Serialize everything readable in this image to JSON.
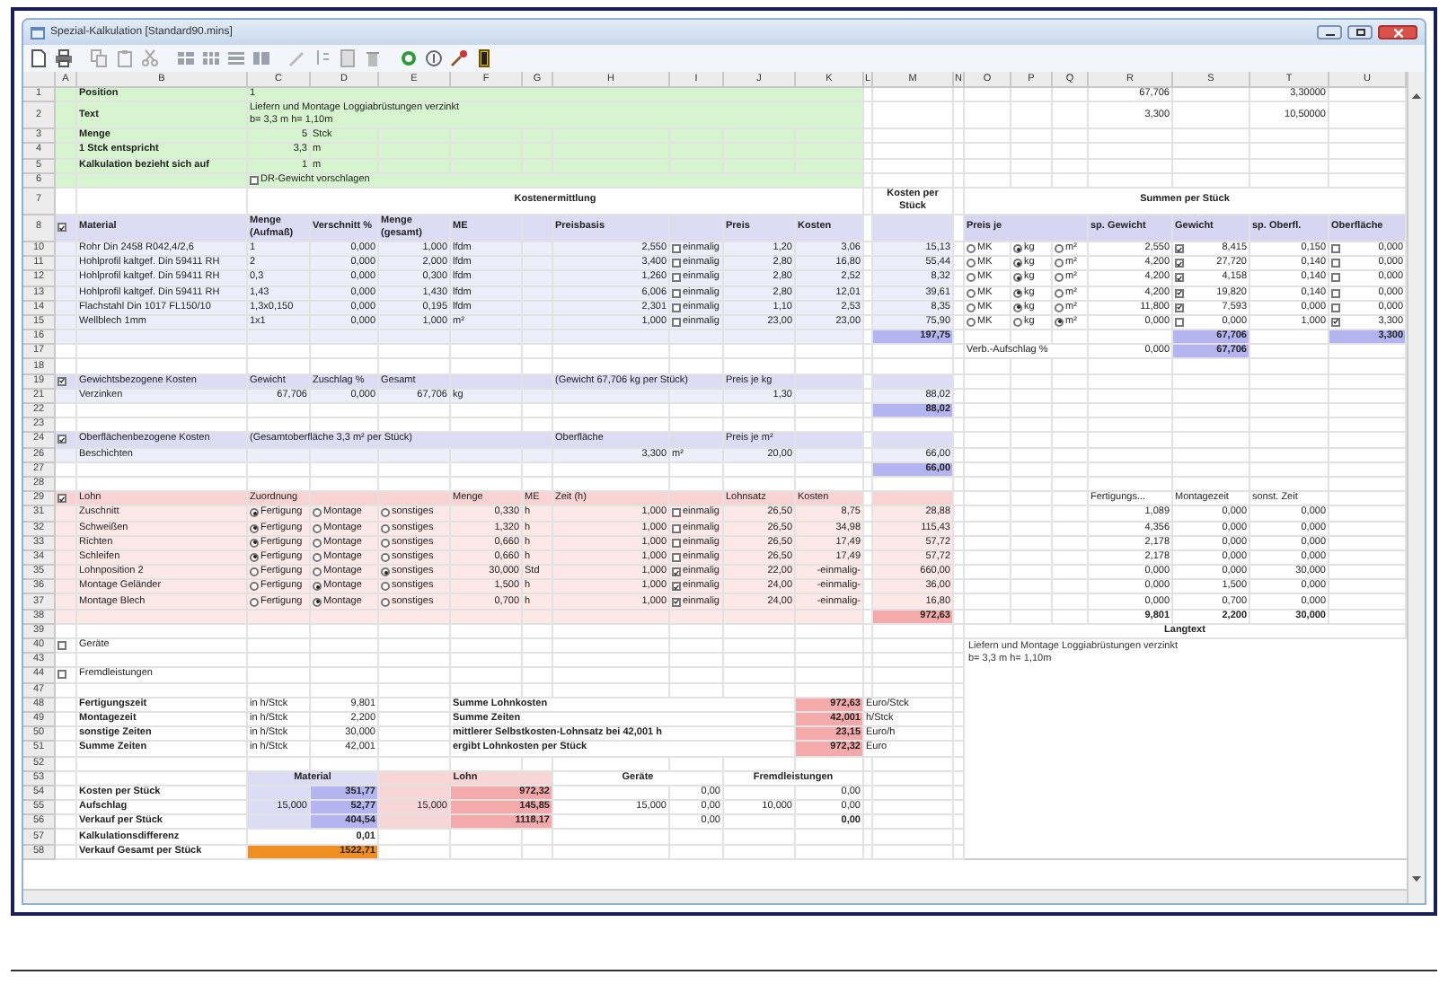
{
  "window": {
    "title": "Spezial-Kalkulation [Standard90.mins]"
  },
  "columns": [
    "A",
    "B",
    "C",
    "D",
    "E",
    "F",
    "G",
    "H",
    "I",
    "J",
    "K",
    "L",
    "M",
    "N",
    "O",
    "P",
    "Q",
    "R",
    "S",
    "T",
    "U"
  ],
  "rows": [
    {
      "number": "1",
      "kind": "header",
      "cells": {
        "B": {
          "kind": "label",
          "text": "Position"
        },
        "C": {
          "kind": "text",
          "merged": true,
          "text": "1"
        },
        "R": {
          "kind": "num",
          "text": "67,706"
        },
        "T": {
          "kind": "num",
          "text": "3,30000"
        }
      }
    },
    {
      "number": "2",
      "kind": "header",
      "cells": {
        "B": {
          "kind": "label",
          "text": "Text"
        },
        "C": {
          "kind": "text",
          "merged": true,
          "lines": [
            "Liefern und  Montage Loggiabrüstungen verzinkt",
            "b= 3,3 m h= 1,10m"
          ]
        },
        "R": {
          "kind": "num",
          "text": "3,300"
        },
        "T": {
          "kind": "num",
          "text": "10,50000"
        }
      }
    },
    {
      "number": "3",
      "kind": "header",
      "cells": {
        "B": {
          "kind": "label",
          "text": "Menge"
        },
        "C": {
          "kind": "num",
          "text": "5"
        },
        "D": {
          "kind": "text",
          "text": "Stck"
        }
      }
    },
    {
      "number": "4",
      "kind": "header",
      "cells": {
        "B": {
          "kind": "label",
          "text": "1 Stck entspricht"
        },
        "C": {
          "kind": "num",
          "text": "3,3"
        },
        "D": {
          "kind": "text",
          "text": "m"
        }
      }
    },
    {
      "number": "5",
      "kind": "header",
      "cells": {
        "B": {
          "kind": "label",
          "text": "Kalkulation bezieht sich auf"
        },
        "C": {
          "kind": "num",
          "text": "1"
        },
        "D": {
          "kind": "text",
          "text": "m"
        }
      }
    },
    {
      "number": "6",
      "kind": "header",
      "cells": {
        "C": {
          "kind": "check",
          "merged": true,
          "checked": false,
          "text": "DR-Gewicht vorschlagen"
        }
      }
    },
    {
      "number": "7",
      "kind": "plain",
      "cells": {
        "C": {
          "kind": "title",
          "merged": true,
          "text": "Kostenermittlung"
        },
        "M": {
          "kind": "title",
          "text": "Kosten per Stück"
        },
        "O": {
          "kind": "title",
          "merged": true,
          "text": "Summen per Stück"
        }
      }
    },
    {
      "number": "8",
      "kind": "material-head",
      "cells": {
        "A": {
          "kind": "check",
          "checked": true
        },
        "B": {
          "kind": "label",
          "text": "Material"
        },
        "C": {
          "kind": "label",
          "text": "Menge (Aufmaß)"
        },
        "D": {
          "kind": "label",
          "text": "Verschnitt %"
        },
        "E": {
          "kind": "label",
          "text": "Menge (gesamt)"
        },
        "F": {
          "kind": "label",
          "text": "ME"
        },
        "H": {
          "kind": "label",
          "text": "Preisbasis"
        },
        "J": {
          "kind": "label",
          "text": "Preis"
        },
        "K": {
          "kind": "label",
          "text": "Kosten"
        },
        "O": {
          "kind": "head",
          "merged": true,
          "text": "Preis je"
        },
        "R": {
          "kind": "head",
          "text": "sp. Gewicht"
        },
        "S": {
          "kind": "head",
          "text": "Gewicht"
        },
        "T": {
          "kind": "head",
          "text": "sp. Oberfl."
        },
        "U": {
          "kind": "head",
          "text": "Oberfläche"
        }
      }
    },
    {
      "number": "10",
      "kind": "material",
      "cells": {
        "B": {
          "kind": "text",
          "text": "Rohr Din 2458 R042,4/2,6"
        },
        "C": {
          "kind": "text",
          "text": "1"
        },
        "D": {
          "kind": "num",
          "text": "0,000"
        },
        "E": {
          "kind": "num",
          "text": "1,000"
        },
        "F": {
          "kind": "text",
          "text": "lfdm"
        },
        "H": {
          "kind": "num",
          "text": "2,550"
        },
        "I": {
          "kind": "check",
          "checked": false,
          "text": "einmalig"
        },
        "J": {
          "kind": "num",
          "text": "1,20"
        },
        "K": {
          "kind": "num",
          "text": "3,06"
        },
        "M": {
          "kind": "num",
          "text": "15,13"
        },
        "O": {
          "kind": "radio",
          "selected": false,
          "text": "MK"
        },
        "P": {
          "kind": "radio",
          "selected": true,
          "text": "kg"
        },
        "Q": {
          "kind": "radio",
          "selected": false,
          "text": "m²"
        },
        "R": {
          "kind": "num",
          "text": "2,550"
        },
        "S": {
          "kind": "checknum",
          "checked": true,
          "text": "8,415"
        },
        "T": {
          "kind": "num",
          "text": "0,150"
        },
        "U": {
          "kind": "checknum",
          "checked": false,
          "text": "0,000"
        }
      }
    },
    {
      "number": "11",
      "kind": "material",
      "cells": {
        "B": {
          "kind": "text",
          "text": "Hohlprofil kaltgef. Din 59411 RH"
        },
        "C": {
          "kind": "text",
          "text": "2"
        },
        "D": {
          "kind": "num",
          "text": "0,000"
        },
        "E": {
          "kind": "num",
          "text": "2,000"
        },
        "F": {
          "kind": "text",
          "text": "lfdm"
        },
        "H": {
          "kind": "num",
          "text": "3,400"
        },
        "I": {
          "kind": "check",
          "checked": false,
          "text": "einmalig"
        },
        "J": {
          "kind": "num",
          "text": "2,80"
        },
        "K": {
          "kind": "num",
          "text": "16,80"
        },
        "M": {
          "kind": "num",
          "text": "55,44"
        },
        "O": {
          "kind": "radio",
          "selected": false,
          "text": "MK"
        },
        "P": {
          "kind": "radio",
          "selected": true,
          "text": "kg"
        },
        "Q": {
          "kind": "radio",
          "selected": false,
          "text": "m²"
        },
        "R": {
          "kind": "num",
          "text": "4,200"
        },
        "S": {
          "kind": "checknum",
          "checked": true,
          "text": "27,720"
        },
        "T": {
          "kind": "num",
          "text": "0,140"
        },
        "U": {
          "kind": "checknum",
          "checked": false,
          "text": "0,000"
        }
      }
    },
    {
      "number": "12",
      "kind": "material",
      "cells": {
        "B": {
          "kind": "text",
          "text": "Hohlprofil kaltgef. Din 59411 RH"
        },
        "C": {
          "kind": "text",
          "text": "0,3"
        },
        "D": {
          "kind": "num",
          "text": "0,000"
        },
        "E": {
          "kind": "num",
          "text": "0,300"
        },
        "F": {
          "kind": "text",
          "text": "lfdm"
        },
        "H": {
          "kind": "num",
          "text": "1,260"
        },
        "I": {
          "kind": "check",
          "checked": false,
          "text": "einmalig"
        },
        "J": {
          "kind": "num",
          "text": "2,80"
        },
        "K": {
          "kind": "num",
          "text": "2,52"
        },
        "M": {
          "kind": "num",
          "text": "8,32"
        },
        "O": {
          "kind": "radio",
          "selected": false,
          "text": "MK"
        },
        "P": {
          "kind": "radio",
          "selected": true,
          "text": "kg"
        },
        "Q": {
          "kind": "radio",
          "selected": false,
          "text": "m²"
        },
        "R": {
          "kind": "num",
          "text": "4,200"
        },
        "S": {
          "kind": "checknum",
          "checked": true,
          "text": "4,158"
        },
        "T": {
          "kind": "num",
          "text": "0,140"
        },
        "U": {
          "kind": "checknum",
          "checked": false,
          "text": "0,000"
        }
      }
    },
    {
      "number": "13",
      "kind": "material",
      "cells": {
        "B": {
          "kind": "text",
          "text": "Hohlprofil kaltgef. Din 59411 RH"
        },
        "C": {
          "kind": "text",
          "text": "1,43"
        },
        "D": {
          "kind": "num",
          "text": "0,000"
        },
        "E": {
          "kind": "num",
          "text": "1,430"
        },
        "F": {
          "kind": "text",
          "text": "lfdm"
        },
        "H": {
          "kind": "num",
          "text": "6,006"
        },
        "I": {
          "kind": "check",
          "checked": false,
          "text": "einmalig"
        },
        "J": {
          "kind": "num",
          "text": "2,80"
        },
        "K": {
          "kind": "num",
          "text": "12,01"
        },
        "M": {
          "kind": "num",
          "text": "39,61"
        },
        "O": {
          "kind": "radio",
          "selected": false,
          "text": "MK"
        },
        "P": {
          "kind": "radio",
          "selected": true,
          "text": "kg"
        },
        "Q": {
          "kind": "radio",
          "selected": false,
          "text": "m²"
        },
        "R": {
          "kind": "num",
          "text": "4,200"
        },
        "S": {
          "kind": "checknum",
          "checked": true,
          "text": "19,820"
        },
        "T": {
          "kind": "num",
          "text": "0,140"
        },
        "U": {
          "kind": "checknum",
          "checked": false,
          "text": "0,000"
        }
      }
    },
    {
      "number": "14",
      "kind": "material",
      "cells": {
        "B": {
          "kind": "text",
          "text": "Flachstahl Din 1017 FL150/10"
        },
        "C": {
          "kind": "text",
          "text": "1,3x0,150"
        },
        "D": {
          "kind": "num",
          "text": "0,000"
        },
        "E": {
          "kind": "num",
          "text": "0,195"
        },
        "F": {
          "kind": "text",
          "text": "lfdm"
        },
        "H": {
          "kind": "num",
          "text": "2,301"
        },
        "I": {
          "kind": "check",
          "checked": false,
          "text": "einmalig"
        },
        "J": {
          "kind": "num",
          "text": "1,10"
        },
        "K": {
          "kind": "num",
          "text": "2,53"
        },
        "M": {
          "kind": "num",
          "text": "8,35"
        },
        "O": {
          "kind": "radio",
          "selected": false,
          "text": "MK"
        },
        "P": {
          "kind": "radio",
          "selected": true,
          "text": "kg"
        },
        "Q": {
          "kind": "radio",
          "selected": false,
          "text": "m²"
        },
        "R": {
          "kind": "num",
          "text": "11,800"
        },
        "S": {
          "kind": "checknum",
          "checked": true,
          "text": "7,593"
        },
        "T": {
          "kind": "num",
          "text": "0,000"
        },
        "U": {
          "kind": "checknum",
          "checked": false,
          "text": "0,000"
        }
      }
    },
    {
      "number": "15",
      "kind": "material",
      "cells": {
        "B": {
          "kind": "text",
          "text": "Wellblech 1mm"
        },
        "C": {
          "kind": "text",
          "text": "1x1"
        },
        "D": {
          "kind": "num",
          "text": "0,000"
        },
        "E": {
          "kind": "num",
          "text": "1,000"
        },
        "F": {
          "kind": "text",
          "text": "m²"
        },
        "H": {
          "kind": "num",
          "text": "1,000"
        },
        "I": {
          "kind": "check",
          "checked": false,
          "text": "einmalig"
        },
        "J": {
          "kind": "num",
          "text": "23,00"
        },
        "K": {
          "kind": "num",
          "text": "23,00"
        },
        "M": {
          "kind": "num",
          "text": "75,90"
        },
        "O": {
          "kind": "radio",
          "selected": false,
          "text": "MK"
        },
        "P": {
          "kind": "radio",
          "selected": false,
          "text": "kg"
        },
        "Q": {
          "kind": "radio",
          "selected": true,
          "text": "m²"
        },
        "R": {
          "kind": "num",
          "text": "0,000"
        },
        "S": {
          "kind": "checknum",
          "checked": false,
          "text": "0,000"
        },
        "T": {
          "kind": "num",
          "text": "1,000"
        },
        "U": {
          "kind": "checknum",
          "checked": true,
          "text": "3,300"
        }
      }
    },
    {
      "number": "16",
      "kind": "material",
      "cells": {
        "M": {
          "kind": "msum",
          "text": "197,75"
        },
        "S": {
          "kind": "msum",
          "text": "67,706"
        },
        "U": {
          "kind": "msum",
          "text": "3,300"
        }
      }
    },
    {
      "number": "17",
      "kind": "plain",
      "cells": {
        "O": {
          "kind": "text",
          "merged": true,
          "text": "Verb.-Aufschlag %"
        },
        "R": {
          "kind": "num",
          "text": "0,000"
        },
        "S": {
          "kind": "msum",
          "text": "67,706"
        }
      }
    },
    {
      "number": "18",
      "kind": "plain",
      "cells": {}
    },
    {
      "number": "19",
      "kind": "material-head",
      "cells": {
        "A": {
          "kind": "check",
          "checked": true
        },
        "B": {
          "kind": "text",
          "text": "Gewichtsbezogene Kosten"
        },
        "C": {
          "kind": "text",
          "text": "Gewicht"
        },
        "D": {
          "kind": "text",
          "text": "Zuschlag %"
        },
        "E": {
          "kind": "text",
          "text": "Gesamt"
        },
        "H": {
          "kind": "text",
          "merged": true,
          "text": "(Gewicht 67,706 kg per Stück)"
        },
        "J": {
          "kind": "text",
          "text": "Preis je kg"
        }
      }
    },
    {
      "number": "21",
      "kind": "material",
      "cells": {
        "B": {
          "kind": "text",
          "text": "Verzinken"
        },
        "C": {
          "kind": "num",
          "text": "67,706"
        },
        "D": {
          "kind": "num",
          "text": "0,000"
        },
        "E": {
          "kind": "num",
          "text": "67,706"
        },
        "F": {
          "kind": "text",
          "text": "kg"
        },
        "J": {
          "kind": "num",
          "text": "1,30"
        },
        "M": {
          "kind": "num",
          "text": "88,02"
        }
      }
    },
    {
      "number": "22",
      "kind": "plain",
      "cells": {
        "M": {
          "kind": "msum",
          "text": "88,02"
        }
      }
    },
    {
      "number": "23",
      "kind": "plain",
      "cells": {}
    },
    {
      "number": "24",
      "kind": "material-head",
      "cells": {
        "A": {
          "kind": "check",
          "checked": true
        },
        "B": {
          "kind": "text",
          "text": "Oberflächenbezogene Kosten"
        },
        "C": {
          "kind": "text",
          "merged": true,
          "text": "(Gesamtoberfläche 3,3 m² per Stück)"
        },
        "H": {
          "kind": "text",
          "text": "Oberfläche"
        },
        "J": {
          "kind": "text",
          "text": "Preis je m²"
        }
      }
    },
    {
      "number": "26",
      "kind": "material",
      "cells": {
        "B": {
          "kind": "text",
          "text": "Beschichten"
        },
        "H": {
          "kind": "num",
          "text": "3,300"
        },
        "I": {
          "kind": "text",
          "text": "m²"
        },
        "J": {
          "kind": "num",
          "text": "20,00"
        },
        "M": {
          "kind": "num",
          "text": "66,00"
        }
      }
    },
    {
      "number": "27",
      "kind": "plain",
      "cells": {
        "M": {
          "kind": "msum",
          "text": "66,00"
        }
      }
    },
    {
      "number": "28",
      "kind": "plain",
      "cells": {}
    },
    {
      "number": "29",
      "kind": "labor-head",
      "cells": {
        "A": {
          "kind": "check",
          "checked": true
        },
        "B": {
          "kind": "text",
          "text": "Lohn"
        },
        "C": {
          "kind": "text",
          "text": "Zuordnung"
        },
        "F": {
          "kind": "text",
          "text": "Menge"
        },
        "G": {
          "kind": "text",
          "text": "ME"
        },
        "H": {
          "kind": "text",
          "text": "Zeit (h)"
        },
        "J": {
          "kind": "text",
          "text": "Lohnsatz"
        },
        "K": {
          "kind": "text",
          "text": "Kosten"
        },
        "R": {
          "kind": "text",
          "text": "Fertigungs..."
        },
        "S": {
          "kind": "text",
          "text": "Montagezeit"
        },
        "T": {
          "kind": "text",
          "text": "sonst. Zeit"
        }
      }
    },
    {
      "number": "31",
      "kind": "labor",
      "cells": {
        "B": {
          "kind": "text",
          "text": "Zuschnitt"
        },
        "C": {
          "kind": "radio",
          "selected": true,
          "text": "Fertigung"
        },
        "D": {
          "kind": "radio",
          "selected": false,
          "text": "Montage"
        },
        "E": {
          "kind": "radio",
          "selected": false,
          "text": "sonstiges"
        },
        "F": {
          "kind": "num",
          "text": "0,330"
        },
        "G": {
          "kind": "text",
          "text": "h"
        },
        "H": {
          "kind": "num",
          "text": "1,000"
        },
        "I": {
          "kind": "check",
          "checked": false,
          "text": "einmalig"
        },
        "J": {
          "kind": "num",
          "text": "26,50"
        },
        "K": {
          "kind": "num",
          "text": "8,75"
        },
        "M": {
          "kind": "num",
          "text": "28,88"
        },
        "R": {
          "kind": "num",
          "text": "1,089"
        },
        "S": {
          "kind": "num",
          "text": "0,000"
        },
        "T": {
          "kind": "num",
          "text": "0,000"
        }
      }
    },
    {
      "number": "32",
      "kind": "labor",
      "cells": {
        "B": {
          "kind": "text",
          "text": "Schweißen"
        },
        "C": {
          "kind": "radio",
          "selected": true,
          "text": "Fertigung"
        },
        "D": {
          "kind": "radio",
          "selected": false,
          "text": "Montage"
        },
        "E": {
          "kind": "radio",
          "selected": false,
          "text": "sonstiges"
        },
        "F": {
          "kind": "num",
          "text": "1,320"
        },
        "G": {
          "kind": "text",
          "text": "h"
        },
        "H": {
          "kind": "num",
          "text": "1,000"
        },
        "I": {
          "kind": "check",
          "checked": false,
          "text": "einmalig"
        },
        "J": {
          "kind": "num",
          "text": "26,50"
        },
        "K": {
          "kind": "num",
          "text": "34,98"
        },
        "M": {
          "kind": "num",
          "text": "115,43"
        },
        "R": {
          "kind": "num",
          "text": "4,356"
        },
        "S": {
          "kind": "num",
          "text": "0,000"
        },
        "T": {
          "kind": "num",
          "text": "0,000"
        }
      }
    },
    {
      "number": "33",
      "kind": "labor",
      "cells": {
        "B": {
          "kind": "text",
          "text": "Richten"
        },
        "C": {
          "kind": "radio",
          "selected": true,
          "text": "Fertigung"
        },
        "D": {
          "kind": "radio",
          "selected": false,
          "text": "Montage"
        },
        "E": {
          "kind": "radio",
          "selected": false,
          "text": "sonstiges"
        },
        "F": {
          "kind": "num",
          "text": "0,660"
        },
        "G": {
          "kind": "text",
          "text": "h"
        },
        "H": {
          "kind": "num",
          "text": "1,000"
        },
        "I": {
          "kind": "check",
          "checked": false,
          "text": "einmalig"
        },
        "J": {
          "kind": "num",
          "text": "26,50"
        },
        "K": {
          "kind": "num",
          "text": "17,49"
        },
        "M": {
          "kind": "num",
          "text": "57,72"
        },
        "R": {
          "kind": "num",
          "text": "2,178"
        },
        "S": {
          "kind": "num",
          "text": "0,000"
        },
        "T": {
          "kind": "num",
          "text": "0,000"
        }
      }
    },
    {
      "number": "34",
      "kind": "labor",
      "cells": {
        "B": {
          "kind": "text",
          "text": "Schleifen"
        },
        "C": {
          "kind": "radio",
          "selected": true,
          "text": "Fertigung"
        },
        "D": {
          "kind": "radio",
          "selected": false,
          "text": "Montage"
        },
        "E": {
          "kind": "radio",
          "selected": false,
          "text": "sonstiges"
        },
        "F": {
          "kind": "num",
          "text": "0,660"
        },
        "G": {
          "kind": "text",
          "text": "h"
        },
        "H": {
          "kind": "num",
          "text": "1,000"
        },
        "I": {
          "kind": "check",
          "checked": false,
          "text": "einmalig"
        },
        "J": {
          "kind": "num",
          "text": "26,50"
        },
        "K": {
          "kind": "num",
          "text": "17,49"
        },
        "M": {
          "kind": "num",
          "text": "57,72"
        },
        "R": {
          "kind": "num",
          "text": "2,178"
        },
        "S": {
          "kind": "num",
          "text": "0,000"
        },
        "T": {
          "kind": "num",
          "text": "0,000"
        }
      }
    },
    {
      "number": "35",
      "kind": "labor",
      "cells": {
        "B": {
          "kind": "text",
          "text": "Lohnposition 2"
        },
        "C": {
          "kind": "radio",
          "selected": false,
          "text": "Fertigung"
        },
        "D": {
          "kind": "radio",
          "selected": false,
          "text": "Montage"
        },
        "E": {
          "kind": "radio",
          "selected": true,
          "text": "sonstiges"
        },
        "F": {
          "kind": "num",
          "text": "30,000"
        },
        "G": {
          "kind": "text",
          "text": "Std"
        },
        "H": {
          "kind": "num",
          "text": "1,000"
        },
        "I": {
          "kind": "check",
          "checked": true,
          "text": "einmalig"
        },
        "J": {
          "kind": "num",
          "text": "22,00"
        },
        "K": {
          "kind": "num",
          "text": "-einmalig-"
        },
        "M": {
          "kind": "num",
          "text": "660,00"
        },
        "R": {
          "kind": "num",
          "text": "0,000"
        },
        "S": {
          "kind": "num",
          "text": "0,000"
        },
        "T": {
          "kind": "num",
          "text": "30,000"
        }
      }
    },
    {
      "number": "36",
      "kind": "labor",
      "cells": {
        "B": {
          "kind": "text",
          "text": "Montage Geländer"
        },
        "C": {
          "kind": "radio",
          "selected": false,
          "text": "Fertigung"
        },
        "D": {
          "kind": "radio",
          "selected": true,
          "text": "Montage"
        },
        "E": {
          "kind": "radio",
          "selected": false,
          "text": "sonstiges"
        },
        "F": {
          "kind": "num",
          "text": "1,500"
        },
        "G": {
          "kind": "text",
          "text": "h"
        },
        "H": {
          "kind": "num",
          "text": "1,000"
        },
        "I": {
          "kind": "check",
          "checked": true,
          "text": "einmalig"
        },
        "J": {
          "kind": "num",
          "text": "24,00"
        },
        "K": {
          "kind": "num",
          "text": "-einmalig-"
        },
        "M": {
          "kind": "num",
          "text": "36,00"
        },
        "R": {
          "kind": "num",
          "text": "0,000"
        },
        "S": {
          "kind": "num",
          "text": "1,500"
        },
        "T": {
          "kind": "num",
          "text": "0,000"
        }
      }
    },
    {
      "number": "37",
      "kind": "labor",
      "cells": {
        "B": {
          "kind": "text",
          "text": "Montage Blech"
        },
        "C": {
          "kind": "radio",
          "selected": false,
          "text": "Fertigung"
        },
        "D": {
          "kind": "radio",
          "selected": true,
          "text": "Montage"
        },
        "E": {
          "kind": "radio",
          "selected": false,
          "text": "sonstiges"
        },
        "F": {
          "kind": "num",
          "text": "0,700"
        },
        "G": {
          "kind": "text",
          "text": "h"
        },
        "H": {
          "kind": "num",
          "text": "1,000"
        },
        "I": {
          "kind": "check",
          "checked": true,
          "text": "einmalig"
        },
        "J": {
          "kind": "num",
          "text": "24,00"
        },
        "K": {
          "kind": "num",
          "text": "-einmalig-"
        },
        "M": {
          "kind": "num",
          "text": "16,80"
        },
        "R": {
          "kind": "num",
          "text": "0,000"
        },
        "S": {
          "kind": "num",
          "text": "0,700"
        },
        "T": {
          "kind": "num",
          "text": "0,000"
        }
      }
    },
    {
      "number": "38",
      "kind": "labor",
      "cells": {
        "M": {
          "kind": "lsum",
          "text": "972,63"
        },
        "R": {
          "kind": "bsum",
          "text": "9,801"
        },
        "S": {
          "kind": "bsum",
          "text": "2,200"
        },
        "T": {
          "kind": "bsum",
          "text": "30,000"
        }
      }
    },
    {
      "number": "39",
      "kind": "plain",
      "cells": {
        "O": {
          "kind": "title",
          "merged": true,
          "text": "Langtext"
        }
      }
    },
    {
      "number": "40",
      "kind": "plain",
      "cells": {
        "A": {
          "kind": "check",
          "checked": false
        },
        "B": {
          "kind": "text",
          "text": "Geräte"
        },
        "O": {
          "kind": "longtext",
          "merged": true,
          "lines": [
            "Liefern und  Montage Loggiabrüstungen verzinkt",
            "b= 3,3 m h= 1,10m"
          ]
        }
      }
    },
    {
      "number": "43",
      "kind": "plain",
      "cells": {}
    },
    {
      "number": "44",
      "kind": "plain",
      "cells": {
        "A": {
          "kind": "check",
          "checked": false
        },
        "B": {
          "kind": "text",
          "text": "Fremdleistungen"
        }
      }
    },
    {
      "number": "47",
      "kind": "plain",
      "cells": {}
    },
    {
      "number": "48",
      "kind": "plain",
      "cells": {
        "B": {
          "kind": "label",
          "text": "Fertigungszeit"
        },
        "C": {
          "kind": "text",
          "text": "in h/Stck"
        },
        "D": {
          "kind": "num",
          "text": "9,801"
        },
        "F": {
          "kind": "label",
          "merged": true,
          "text": "Summe Lohnkosten"
        },
        "K": {
          "kind": "lsum",
          "text": "972,63"
        },
        "L": {
          "kind": "text",
          "merged": true,
          "text": "Euro/Stck"
        }
      }
    },
    {
      "number": "49",
      "kind": "plain",
      "cells": {
        "B": {
          "kind": "label",
          "text": "Montagezeit"
        },
        "C": {
          "kind": "text",
          "text": "in h/Stck"
        },
        "D": {
          "kind": "num",
          "text": "2,200"
        },
        "F": {
          "kind": "label",
          "merged": true,
          "text": "Summe Zeiten"
        },
        "K": {
          "kind": "lsum",
          "text": "42,001"
        },
        "L": {
          "kind": "text",
          "merged": true,
          "text": "h/Stck"
        }
      }
    },
    {
      "number": "50",
      "kind": "plain",
      "cells": {
        "B": {
          "kind": "label",
          "text": "sonstige Zeiten"
        },
        "C": {
          "kind": "text",
          "text": "in h/Stck"
        },
        "D": {
          "kind": "num",
          "text": "30,000"
        },
        "F": {
          "kind": "label",
          "merged": true,
          "text": "mittlerer Selbstkosten-Lohnsatz bei 42,001 h"
        },
        "K": {
          "kind": "lsum",
          "text": "23,15"
        },
        "L": {
          "kind": "text",
          "merged": true,
          "text": "Euro/h"
        }
      }
    },
    {
      "number": "51",
      "kind": "plain",
      "cells": {
        "B": {
          "kind": "label",
          "text": "Summe Zeiten"
        },
        "C": {
          "kind": "text",
          "text": "in h/Stck"
        },
        "D": {
          "kind": "num",
          "text": "42,001"
        },
        "F": {
          "kind": "label",
          "merged": true,
          "text": "ergibt Lohnkosten per Stück"
        },
        "K": {
          "kind": "lsum",
          "text": "972,32"
        },
        "L": {
          "kind": "text",
          "merged": true,
          "text": "Euro"
        }
      }
    },
    {
      "number": "52",
      "kind": "plain",
      "cells": {}
    },
    {
      "number": "53",
      "kind": "plain",
      "cells": {
        "C": {
          "kind": "mtitle",
          "merged": true,
          "text": "Material"
        },
        "E": {
          "kind": "ltitle",
          "merged": true,
          "text": "Lohn"
        },
        "H": {
          "kind": "title",
          "merged": true,
          "text": "Geräte"
        },
        "J": {
          "kind": "title",
          "merged": true,
          "text": "Fremdleistungen"
        }
      }
    },
    {
      "number": "54",
      "kind": "plain",
      "cells": {
        "B": {
          "kind": "label",
          "text": "Kosten per Stück"
        },
        "C": {
          "kind": "mtint"
        },
        "D": {
          "kind": "msum",
          "text": "351,77"
        },
        "E": {
          "kind": "ltint"
        },
        "F": {
          "kind": "lsum",
          "merged": true,
          "text": "972,32"
        },
        "H": {
          "kind": "blank"
        },
        "I": {
          "kind": "num",
          "text": "0,00"
        },
        "K": {
          "kind": "num",
          "text": "0,00"
        }
      }
    },
    {
      "number": "55",
      "kind": "plain",
      "cells": {
        "B": {
          "kind": "label",
          "text": "Aufschlag"
        },
        "C": {
          "kind": "mtint",
          "text": "15,000"
        },
        "D": {
          "kind": "msum",
          "text": "52,77"
        },
        "E": {
          "kind": "ltint",
          "text": "15,000"
        },
        "F": {
          "kind": "lsum",
          "merged": true,
          "text": "145,85"
        },
        "H": {
          "kind": "num",
          "text": "15,000"
        },
        "I": {
          "kind": "num",
          "text": "0,00"
        },
        "J": {
          "kind": "num",
          "text": "10,000"
        },
        "K": {
          "kind": "num",
          "text": "0,00"
        }
      }
    },
    {
      "number": "56",
      "kind": "plain",
      "cells": {
        "B": {
          "kind": "label",
          "text": "Verkauf per Stück"
        },
        "C": {
          "kind": "mtint"
        },
        "D": {
          "kind": "msum",
          "text": "404,54"
        },
        "E": {
          "kind": "ltint"
        },
        "F": {
          "kind": "lsum",
          "merged": true,
          "text": "1118,17"
        },
        "H": {
          "kind": "blank"
        },
        "I": {
          "kind": "num",
          "text": "0,00"
        },
        "K": {
          "kind": "bsum",
          "text": "0,00"
        }
      }
    },
    {
      "number": "57",
      "kind": "plain",
      "cells": {
        "B": {
          "kind": "label",
          "text": "Kalkulationsdifferenz"
        },
        "C": {
          "kind": "bsum",
          "merged": true,
          "text": "0,01"
        },
        "E": {
          "kind": "blank"
        }
      }
    },
    {
      "number": "58",
      "kind": "plain",
      "cells": {
        "B": {
          "kind": "label",
          "text": "Verkauf Gesamt per Stück"
        },
        "C": {
          "kind": "gsum",
          "merged": true,
          "text": "1522,71"
        },
        "E": {
          "kind": "blank"
        }
      }
    }
  ]
}
